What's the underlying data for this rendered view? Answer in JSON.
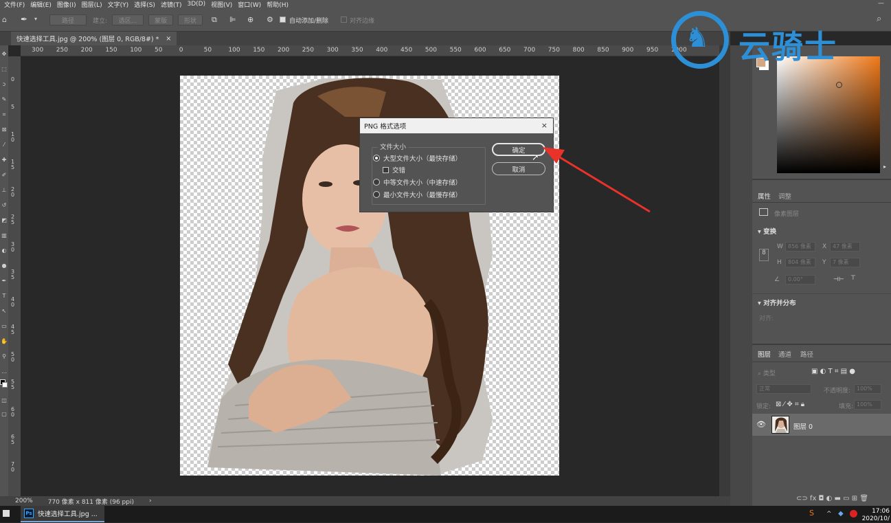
{
  "menubar": {
    "items": [
      "文件(F)",
      "编辑(E)",
      "图像(I)",
      "图层(L)",
      "文字(Y)",
      "选择(S)",
      "滤镜(T)",
      "3D(D)",
      "视图(V)",
      "窗口(W)",
      "帮助(H)"
    ]
  },
  "options": {
    "path_btn": "路径",
    "build_label": "建立:",
    "selection_btn": "选区...",
    "mask_btn": "蒙版",
    "shape_btn": "形状",
    "auto_add_delete": "自动添加/删除",
    "align_edges": "对齐边缘"
  },
  "doc_tab": {
    "title": "快速选择工具.jpg @ 200% (图层 0, RGB/8#) *",
    "close": "×"
  },
  "ruler": {
    "h_ticks": [
      "300",
      "250",
      "200",
      "150",
      "100",
      "50",
      "0",
      "50",
      "100",
      "150",
      "200",
      "250",
      "300",
      "350",
      "400",
      "450",
      "500",
      "550",
      "600",
      "650",
      "700",
      "750",
      "800",
      "850",
      "900",
      "950",
      "1000"
    ],
    "v_ticks": [
      "0",
      "5",
      "1 0",
      "1 5",
      "2 0",
      "2 5",
      "3 0",
      "3 5",
      "4 0",
      "4 5",
      "5 0",
      "5 5",
      "6 0",
      "6 5",
      "7 0"
    ]
  },
  "status": {
    "zoom": "200%",
    "size": "770 像素 x 811 像素 (96 ppi)",
    "arrow": "›"
  },
  "taskbar": {
    "app_label": "快速选择工具.jpg ...",
    "time": "17:06",
    "date": "2020/10/"
  },
  "properties": {
    "tab_props": "属性",
    "tab_adjust": "调整",
    "pixel_layer": "像素图层",
    "transform": "变换",
    "w_label": "W",
    "w_value": "856 像素",
    "x_label": "X",
    "x_value": "47 像素",
    "h_label": "H",
    "h_value": "804 像素",
    "y_label": "Y",
    "y_value": "7 像素",
    "angle_value": "0.00°",
    "align": "对齐并分布",
    "align_label": "对齐:"
  },
  "layers": {
    "tab_layers": "图层",
    "tab_channels": "通道",
    "tab_paths": "路径",
    "kind": "类型",
    "blend": "正常",
    "opacity_label": "不透明度:",
    "opacity_value": "100%",
    "lock_label": "锁定:",
    "fill_label": "填充:",
    "fill_value": "100%",
    "layer_name": "图层 0"
  },
  "dialog": {
    "title": "PNG 格式选项",
    "close": "×",
    "group_label": "文件大小",
    "opt_large": "大型文件大小（最快存储）",
    "opt_interlace": "交错",
    "opt_medium": "中等文件大小（中速存储）",
    "opt_small": "最小文件大小（最慢存储）",
    "ok": "确定",
    "cancel": "取消"
  },
  "watermark": {
    "text": "云骑士"
  },
  "colors": {
    "accent_blue": "#2d8fd6",
    "annotation_red": "#e8322a",
    "swatch": "#d5a683"
  }
}
